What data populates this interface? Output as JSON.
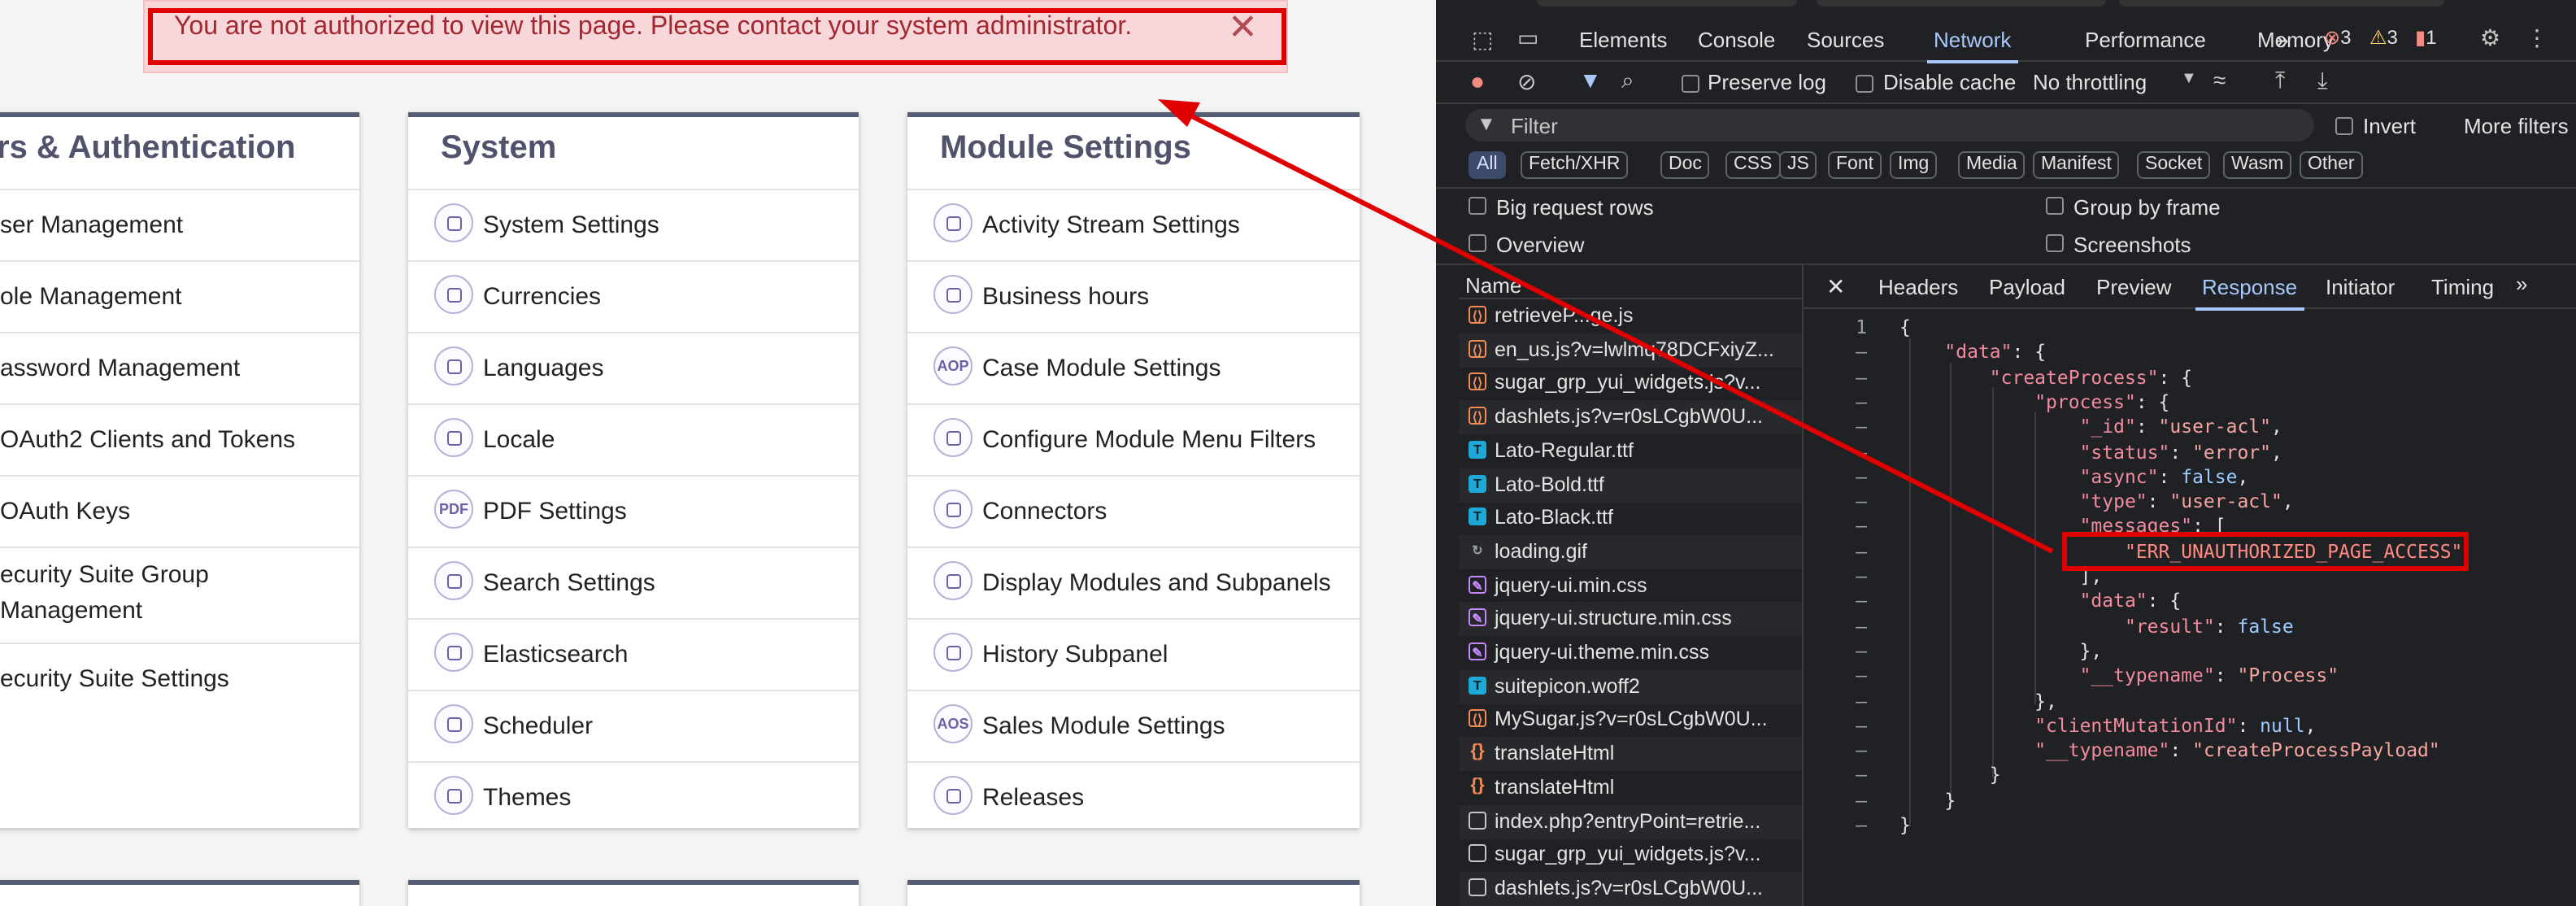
{
  "alert": {
    "message": "You are not authorized to view this page. Please contact your system administrator.",
    "close_glyph": "✕"
  },
  "panels": {
    "users": {
      "title": "rs & Authentication",
      "items": [
        "ser Management",
        "ole Management",
        "assword Management",
        "OAuth2 Clients and Tokens",
        "OAuth Keys",
        "ecurity Suite Group Management",
        "ecurity Suite Settings"
      ]
    },
    "system": {
      "title": "System",
      "items": [
        {
          "label": "System Settings",
          "icon": "gear-icon"
        },
        {
          "label": "Currencies",
          "icon": "coins-icon"
        },
        {
          "label": "Languages",
          "icon": "speech-bubble-icon"
        },
        {
          "label": "Locale",
          "icon": "navigation-arrow-icon"
        },
        {
          "label": "PDF Settings",
          "icon": "pdf-icon",
          "glyph": "PDF"
        },
        {
          "label": "Search Settings",
          "icon": "search-settings-icon"
        },
        {
          "label": "Elasticsearch",
          "icon": "elasticsearch-icon"
        },
        {
          "label": "Scheduler",
          "icon": "clock-icon"
        },
        {
          "label": "Themes",
          "icon": "themes-icon"
        }
      ]
    },
    "modules": {
      "title": "Module Settings",
      "items": [
        {
          "label": "Activity Stream Settings",
          "icon": "lightning-icon"
        },
        {
          "label": "Business hours",
          "icon": "clock-icon"
        },
        {
          "label": "Case Module Settings",
          "icon": "aop-icon",
          "glyph": "AOP"
        },
        {
          "label": "Configure Module Menu Filters",
          "icon": "sliders-icon"
        },
        {
          "label": "Connectors",
          "icon": "connectors-icon"
        },
        {
          "label": "Display Modules and Subpanels",
          "icon": "monitor-icon"
        },
        {
          "label": "History Subpanel",
          "icon": "history-icon"
        },
        {
          "label": "Sales Module Settings",
          "icon": "aos-icon",
          "glyph": "AOS"
        },
        {
          "label": "Releases",
          "icon": "stack-icon"
        }
      ]
    }
  },
  "devtools": {
    "tabs": [
      "Elements",
      "Console",
      "Sources",
      "Network",
      "Performance",
      "Memory"
    ],
    "active_tab": "Network",
    "more_tabs": "»",
    "errors": "3",
    "warnings": "3",
    "issues": "1",
    "toolbar": {
      "preserve_log": "Preserve log",
      "disable_cache": "Disable cache",
      "throttling": "No throttling"
    },
    "filter": {
      "placeholder": "Filter",
      "invert": "Invert",
      "more_filters": "More filters"
    },
    "types": [
      "All",
      "Fetch/XHR",
      "Doc",
      "CSS",
      "JS",
      "Font",
      "Img",
      "Media",
      "Manifest",
      "Socket",
      "Wasm",
      "Other"
    ],
    "options": {
      "big_request_rows": "Big request rows",
      "group_by_frame": "Group by frame",
      "overview": "Overview",
      "screenshots": "Screenshots"
    },
    "name_header": "Name",
    "requests": [
      {
        "name": "retrieveP...ge.js",
        "type": "js"
      },
      {
        "name": "en_us.js?v=lwlmq78DCFxiyZ...",
        "type": "js"
      },
      {
        "name": "sugar_grp_yui_widgets.js?v...",
        "type": "js"
      },
      {
        "name": "dashlets.js?v=r0sLCgbW0U...",
        "type": "js"
      },
      {
        "name": "Lato-Regular.ttf",
        "type": "font"
      },
      {
        "name": "Lato-Bold.ttf",
        "type": "font"
      },
      {
        "name": "Lato-Black.ttf",
        "type": "font"
      },
      {
        "name": "loading.gif",
        "type": "gif"
      },
      {
        "name": "jquery-ui.min.css",
        "type": "css"
      },
      {
        "name": "jquery-ui.structure.min.css",
        "type": "css"
      },
      {
        "name": "jquery-ui.theme.min.css",
        "type": "css"
      },
      {
        "name": "suitepicon.woff2",
        "type": "font"
      },
      {
        "name": "MySugar.js?v=r0sLCgbW0U...",
        "type": "js"
      },
      {
        "name": "translateHtml",
        "type": "xhr"
      },
      {
        "name": "translateHtml",
        "type": "xhr"
      },
      {
        "name": "index.php?entryPoint=retrie...",
        "type": "doc"
      },
      {
        "name": "sugar_grp_yui_widgets.js?v...",
        "type": "doc"
      },
      {
        "name": "dashlets.js?v=r0sLCgbW0U...",
        "type": "doc"
      }
    ],
    "detail_tabs": [
      "Headers",
      "Payload",
      "Preview",
      "Response",
      "Initiator",
      "Timing"
    ],
    "active_detail_tab": "Response",
    "close_glyph": "✕",
    "response_lines": [
      {
        "num": "1",
        "text": "{"
      },
      {
        "num": "–",
        "text": "    \"data\": {"
      },
      {
        "num": "–",
        "text": "        \"createProcess\": {"
      },
      {
        "num": "–",
        "text": "            \"process\": {"
      },
      {
        "num": "–",
        "text": "                \"_id\": \"user-acl\","
      },
      {
        "num": "–",
        "text": "                \"status\": \"error\","
      },
      {
        "num": "–",
        "text": "                \"async\": false,"
      },
      {
        "num": "–",
        "text": "                \"type\": \"user-acl\","
      },
      {
        "num": "–",
        "text": "                \"messages\": ["
      },
      {
        "num": "–",
        "text": "                    \"ERR_UNAUTHORIZED_PAGE_ACCESS\""
      },
      {
        "num": "–",
        "text": "                ],"
      },
      {
        "num": "–",
        "text": "                \"data\": {"
      },
      {
        "num": "–",
        "text": "                    \"result\": false"
      },
      {
        "num": "–",
        "text": "                },"
      },
      {
        "num": "–",
        "text": "                \"__typename\": \"Process\""
      },
      {
        "num": "–",
        "text": "            },"
      },
      {
        "num": "–",
        "text": "            \"clientMutationId\": null,"
      },
      {
        "num": "–",
        "text": "            \"__typename\": \"createProcessPayload\""
      },
      {
        "num": "–",
        "text": "        }"
      },
      {
        "num": "–",
        "text": "    }"
      },
      {
        "num": "–",
        "text": "}"
      }
    ]
  },
  "colors": {
    "annotation_red": "#e00000",
    "panel_header": "#565d73",
    "devtools_bg": "#202124",
    "devtools_accent": "#a8c7fa"
  }
}
